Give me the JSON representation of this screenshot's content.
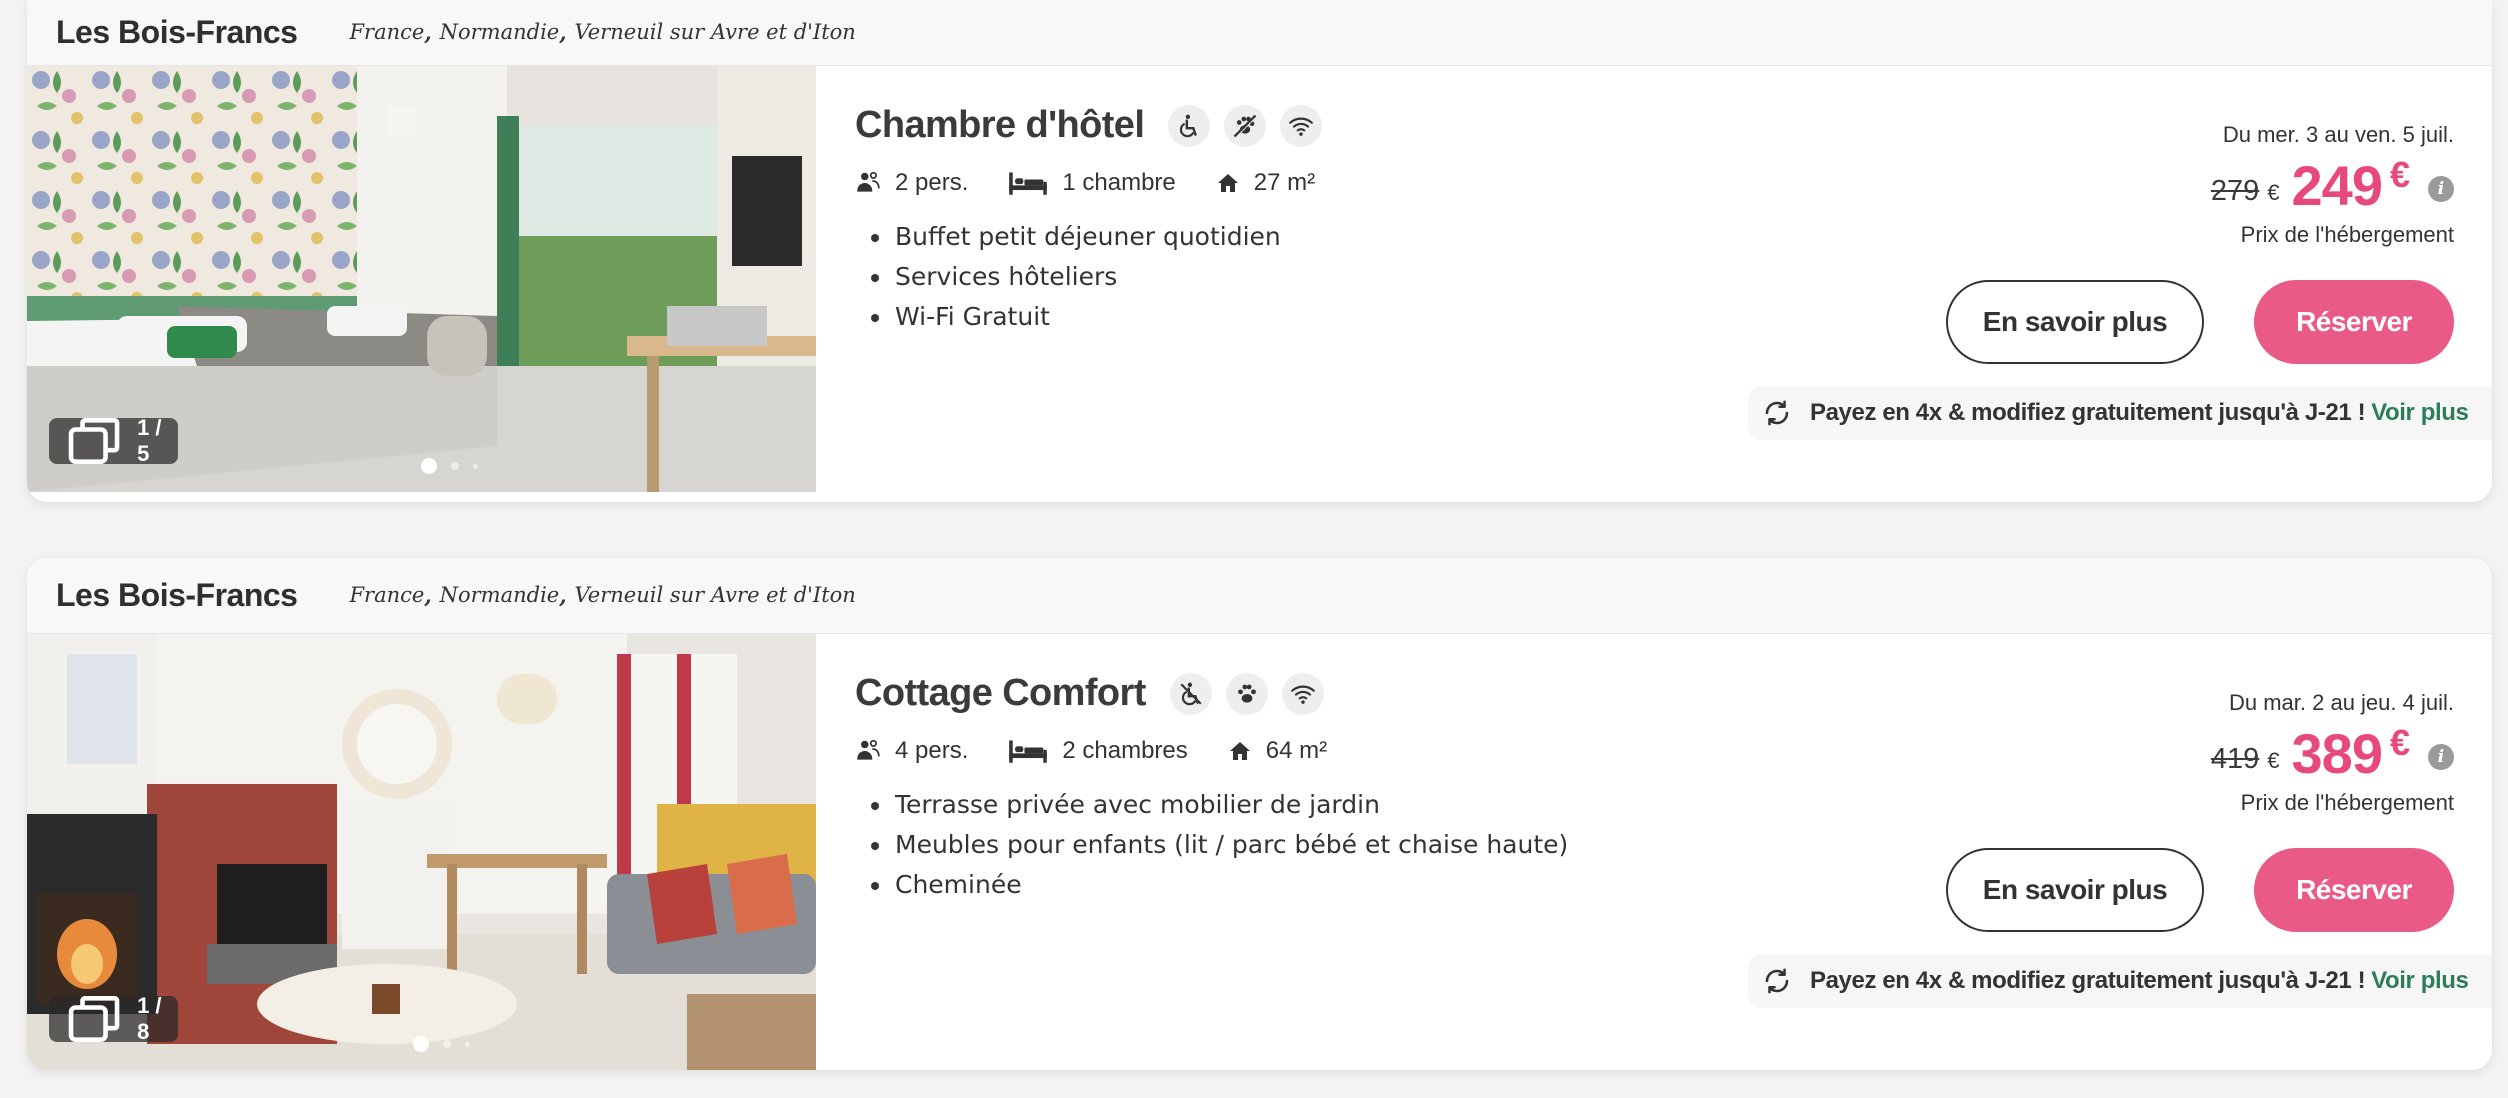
{
  "cards": [
    {
      "site_name": "Les Bois-Francs",
      "location": [
        "France",
        "Normandie",
        "Verneuil sur Avre et d'Iton"
      ],
      "photo_counter": "1 / 5",
      "title": "Chambre d'hôtel",
      "amenities": [
        "wheelchair-icon",
        "no-pets-icon",
        "wifi-icon"
      ],
      "specs": {
        "persons": "2 pers.",
        "rooms": "1 chambre",
        "area": "27 m²"
      },
      "features": [
        "Buffet petit déjeuner quotidien",
        "Services hôteliers",
        "Wi-Fi Gratuit"
      ],
      "dates": "Du mer. 3 au ven. 5 juil.",
      "old_price": "279",
      "currency": "€",
      "new_price": "249",
      "price_label": "Prix de l'hébergement",
      "more_label": "En savoir plus",
      "book_label": "Réserver",
      "promo_text": "Payez en 4x & modifiez gratuitement jusqu'à J-21 !",
      "promo_link": "Voir plus"
    },
    {
      "site_name": "Les Bois-Francs",
      "location": [
        "France",
        "Normandie",
        "Verneuil sur Avre et d'Iton"
      ],
      "photo_counter": "1 / 8",
      "title": "Cottage Comfort",
      "amenities": [
        "no-wheelchair-icon",
        "pets-icon",
        "wifi-icon"
      ],
      "specs": {
        "persons": "4 pers.",
        "rooms": "2 chambres",
        "area": "64 m²"
      },
      "features": [
        "Terrasse privée avec mobilier de jardin",
        "Meubles pour enfants (lit / parc bébé et chaise haute)",
        "Cheminée"
      ],
      "dates": "Du mar. 2 au jeu. 4 juil.",
      "old_price": "419",
      "currency": "€",
      "new_price": "389",
      "price_label": "Prix de l'hébergement",
      "more_label": "En savoir plus",
      "book_label": "Réserver",
      "promo_text": "Payez en 4x & modifiez gratuitement jusqu'à J-21 !",
      "promo_link": "Voir plus"
    }
  ],
  "colors": {
    "accent": "#ea5a87",
    "price": "#e8497d",
    "link": "#2e7d5a"
  }
}
